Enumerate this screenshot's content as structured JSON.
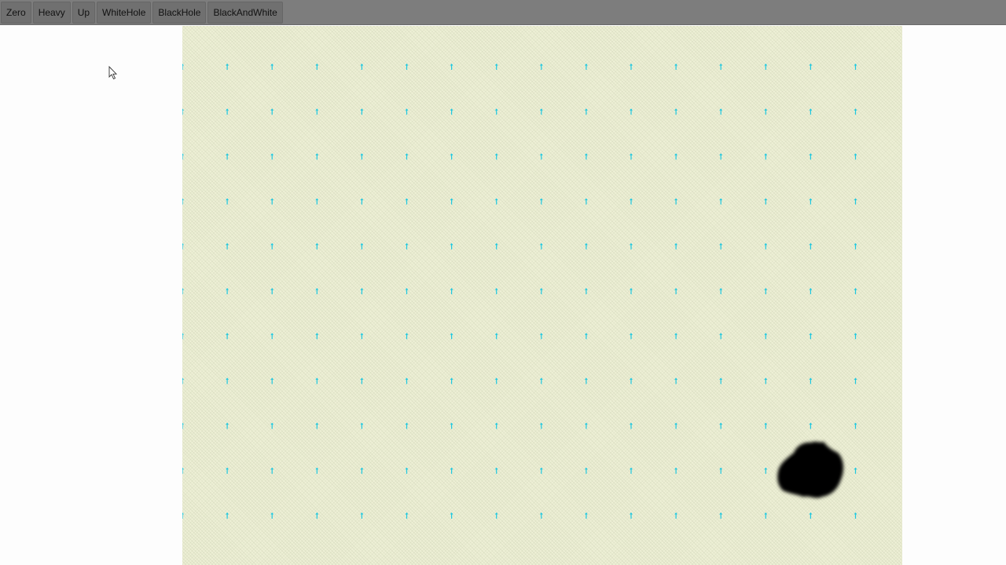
{
  "toolbar": {
    "buttons": [
      {
        "label": "Zero"
      },
      {
        "label": "Heavy"
      },
      {
        "label": "Up"
      },
      {
        "label": "WhiteHole"
      },
      {
        "label": "BlackHole"
      },
      {
        "label": "BlackAndWhite"
      }
    ]
  },
  "field": {
    "background_color": "#eef0d6",
    "arrow_color": "#1ec8e0",
    "arrow_direction": "up",
    "grid_columns": 16,
    "grid_rows": 11,
    "black_hole": {
      "color": "#000000",
      "present": true
    }
  }
}
